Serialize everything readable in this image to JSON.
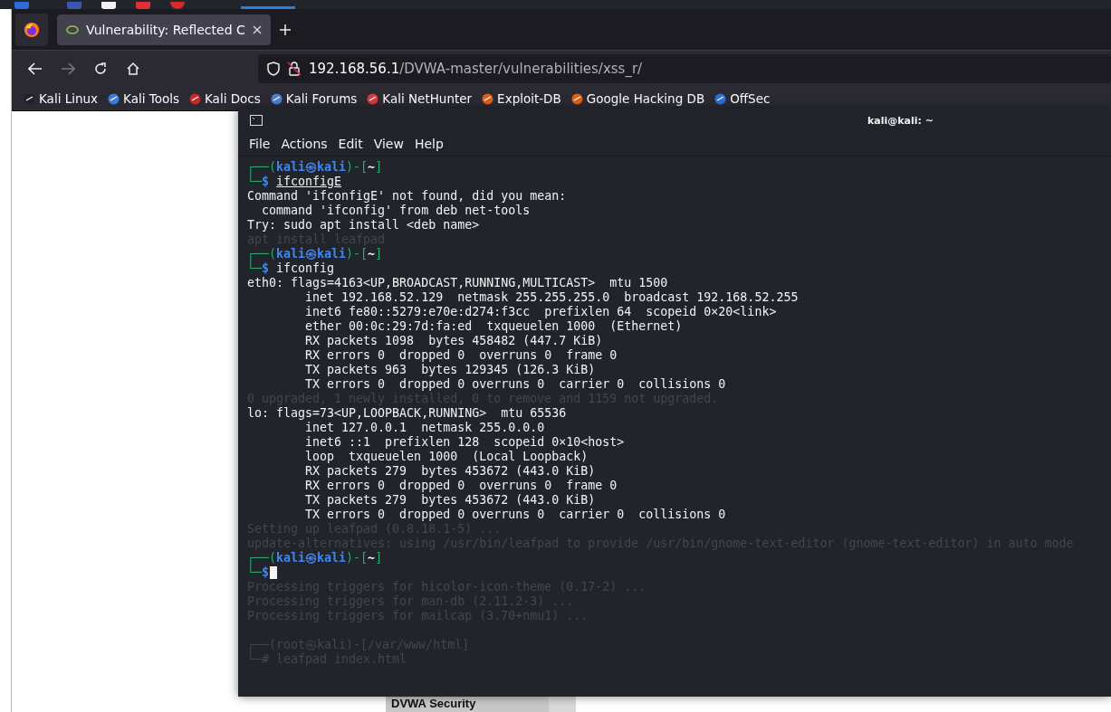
{
  "browser": {
    "tabs": [
      {
        "title": "Vulnerability: Reflected C",
        "selected": true
      }
    ],
    "nav": {
      "back_disabled": false,
      "forward_disabled": true
    },
    "url": {
      "host": "192.168.56.1",
      "path": "/DVWA-master/vulnerabilities/xss_r/"
    },
    "bookmarks": [
      {
        "label": "Kali Linux",
        "color": "#222222"
      },
      {
        "label": "Kali Tools",
        "color": "#3a7bd5"
      },
      {
        "label": "Kali Docs",
        "color": "#c62828"
      },
      {
        "label": "Kali Forums",
        "color": "#4a7fd0"
      },
      {
        "label": "Kali NetHunter",
        "color": "#d63a3a"
      },
      {
        "label": "Exploit-DB",
        "color": "#e0601a"
      },
      {
        "label": "Google Hacking DB",
        "color": "#e0601a"
      },
      {
        "label": "OffSec",
        "color": "#2d6fd8"
      }
    ]
  },
  "page": {
    "menu_items": [
      "DVWA Security"
    ]
  },
  "terminal": {
    "title": "kali@kali: ~",
    "menu": [
      "File",
      "Actions",
      "Edit",
      "View",
      "Help"
    ],
    "lines": [
      {
        "kind": "prompt",
        "head": "┌──(",
        "user": "kali㉿kali",
        "sep": ")-[",
        "dir": "~",
        "tail": "]"
      },
      {
        "kind": "command",
        "corner": "└─",
        "symbol": "$",
        "text": "ifconfigE",
        "underlined": true,
        "cursor": false
      },
      {
        "kind": "output",
        "text": "Command 'ifconfigE' not found, did you mean:"
      },
      {
        "kind": "output",
        "text": "  command 'ifconfig' from deb net-tools"
      },
      {
        "kind": "output",
        "text": "Try: sudo apt install <deb name>"
      },
      {
        "kind": "ghost",
        "text": "apt install leafpad"
      },
      {
        "kind": "prompt",
        "head": "┌──(",
        "user": "kali㉿kali",
        "sep": ")-[",
        "dir": "~",
        "tail": "]"
      },
      {
        "kind": "command",
        "corner": "└─",
        "symbol": "$",
        "text": "ifconfig",
        "underlined": false,
        "cursor": false
      },
      {
        "kind": "output",
        "text": "eth0: flags=4163<UP,BROADCAST,RUNNING,MULTICAST>  mtu 1500"
      },
      {
        "kind": "output",
        "text": "        inet 192.168.52.129  netmask 255.255.255.0  broadcast 192.168.52.255"
      },
      {
        "kind": "output",
        "text": "        inet6 fe80::5279:e70e:d274:f3cc  prefixlen 64  scopeid 0×20<link>"
      },
      {
        "kind": "output",
        "text": "        ether 00:0c:29:7d:fa:ed  txqueuelen 1000  (Ethernet)"
      },
      {
        "kind": "output",
        "text": "        RX packets 1098  bytes 458482 (447.7 KiB)"
      },
      {
        "kind": "output",
        "text": "        RX errors 0  dropped 0  overruns 0  frame 0"
      },
      {
        "kind": "output",
        "text": "        TX packets 963  bytes 129345 (126.3 KiB)"
      },
      {
        "kind": "output",
        "text": "        TX errors 0  dropped 0 overruns 0  carrier 0  collisions 0"
      },
      {
        "kind": "ghost",
        "text": "0 upgraded, 1 newly installed, 0 to remove and 1159 not upgraded."
      },
      {
        "kind": "output",
        "text": "lo: flags=73<UP,LOOPBACK,RUNNING>  mtu 65536"
      },
      {
        "kind": "output",
        "text": "        inet 127.0.0.1  netmask 255.0.0.0"
      },
      {
        "kind": "output",
        "text": "        inet6 ::1  prefixlen 128  scopeid 0×10<host>"
      },
      {
        "kind": "output",
        "text": "        loop  txqueuelen 1000  (Local Loopback)"
      },
      {
        "kind": "output",
        "text": "        RX packets 279  bytes 453672 (443.0 KiB)"
      },
      {
        "kind": "output",
        "text": "        RX errors 0  dropped 0  overruns 0  frame 0"
      },
      {
        "kind": "output",
        "text": "        TX packets 279  bytes 453672 (443.0 KiB)"
      },
      {
        "kind": "output",
        "text": "        TX errors 0  dropped 0 overruns 0  carrier 0  collisions 0"
      },
      {
        "kind": "ghost",
        "text": "Setting up leafpad (0.8.18.1-5) ..."
      },
      {
        "kind": "ghost",
        "text": "update-alternatives: using /usr/bin/leafpad to provide /usr/bin/gnome-text-editor (gnome-text-editor) in auto mode"
      },
      {
        "kind": "prompt",
        "head": "┌──(",
        "user": "kali㉿kali",
        "sep": ")-[",
        "dir": "~",
        "tail": "]"
      },
      {
        "kind": "command",
        "corner": "└─",
        "symbol": "$",
        "cursor": true
      },
      {
        "kind": "ghost",
        "text": "Processing triggers for hicolor-icon-theme (0.17-2) ..."
      },
      {
        "kind": "ghost",
        "text": "Processing triggers for man-db (2.11.2-3) ..."
      },
      {
        "kind": "ghost",
        "text": "Processing triggers for mailcap (3.70+nmu1) ..."
      },
      {
        "kind": "blank"
      },
      {
        "kind": "ghost",
        "text": "┌──(root㉿kali)-[/var/www/html]"
      },
      {
        "kind": "ghost",
        "text": "└─# leafpad index.html"
      }
    ]
  }
}
